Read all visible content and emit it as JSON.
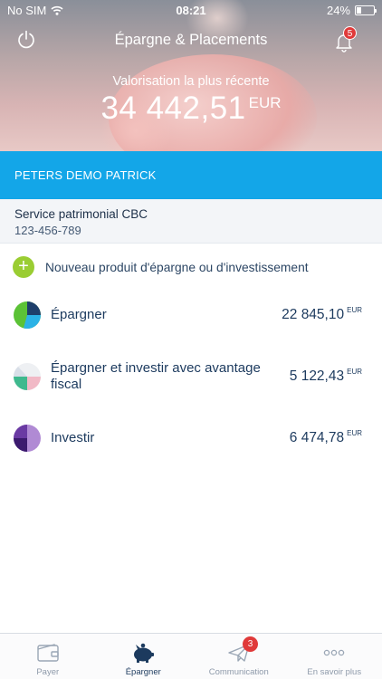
{
  "status_bar": {
    "carrier": "No SIM",
    "time": "08:21",
    "battery": "24%",
    "battery_level": 0.24
  },
  "header": {
    "title": "Épargne & Placements",
    "notification_count": "5",
    "valuation_label": "Valorisation la plus récente",
    "valuation_amount": "34 442,51",
    "valuation_currency": "EUR"
  },
  "client": {
    "name": "PETERS DEMO PATRICK"
  },
  "service": {
    "name": "Service patrimonial CBC",
    "number": "123-456-789"
  },
  "new_product": {
    "label": "Nouveau produit d'épargne ou d'investissement"
  },
  "products": [
    {
      "name": "Épargner",
      "value": "22 845,10",
      "currency": "EUR"
    },
    {
      "name": "Épargner et investir avec avantage fiscal",
      "value": "5 122,43",
      "currency": "EUR"
    },
    {
      "name": "Investir",
      "value": "6 474,78",
      "currency": "EUR"
    }
  ],
  "tabs": [
    {
      "label": "Payer",
      "icon": "wallet-icon",
      "active": false
    },
    {
      "label": "Épargner",
      "icon": "piggy-bank-icon",
      "active": true
    },
    {
      "label": "Communication",
      "icon": "paper-plane-icon",
      "active": false,
      "badge": "3"
    },
    {
      "label": "En savoir plus",
      "icon": "more-dots-icon",
      "active": false
    }
  ],
  "colors": {
    "accent_blue": "#13a6e8",
    "navy": "#1c3a5e",
    "add_green": "#9acd32",
    "badge_red": "#e03a3a"
  }
}
